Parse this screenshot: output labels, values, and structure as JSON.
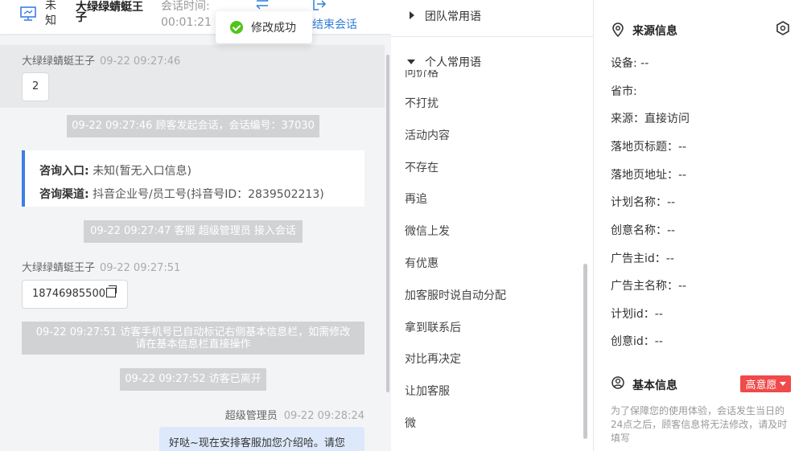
{
  "header": {
    "source": "未知",
    "visitor_name": "大绿绿蜻蜓王子",
    "duration_label": "会话时间:",
    "duration_value": "00:01:21",
    "end_session": "结束会话"
  },
  "toast": {
    "text": "修改成功"
  },
  "messages": {
    "visitor_name": "大绿绿蜻蜓王子",
    "m1_time": "09-22 09:27:46",
    "m1_text": "2",
    "sys1": "09-22 09:27:46 顾客发起会话，会话编号：37030",
    "card_entry_label": "咨询入口:",
    "card_entry_value": "未知(暂无入口信息)",
    "card_channel_label": "咨询渠道:",
    "card_channel_value": "抖音企业号/员工号(抖音号ID：2839502213)",
    "sys2": "09-22 09:27:47 客服 超级管理员 接入会话",
    "m2_time": "09-22 09:27:51",
    "m2_text": "18746985500",
    "sys3_line1": "09-22 09:27:51 访客手机号已自动标记右侧基本信息栏，如需修改",
    "sys3_line2": "请在基本信息栏直接操作",
    "sys4": "09-22 09:27:52 访客已离开",
    "agent_name": "超级管理员",
    "agent_time": "09-22 09:28:24",
    "agent_text": "好哒~现在安排客服加您介绍哈。请您"
  },
  "phrases": {
    "team_group": "团队常用语",
    "personal_group": "个人常用语",
    "cut_item": "问价格",
    "items": [
      "不打扰",
      "活动内容",
      "不存在",
      "再追",
      "微信上发",
      "有优惠",
      "加客服时说自动分配",
      "拿到联系后",
      "对比再决定",
      "让加客服",
      "微"
    ]
  },
  "info": {
    "source_title": "来源信息",
    "fields": [
      "设备: --",
      "省市:",
      "来源：直接访问",
      "落地页标题：--",
      "落地页地址：--",
      "计划名称：--",
      "创意名称：--",
      "广告主id：--",
      "广告主名称：--",
      "计划id：--",
      "创意id：--"
    ],
    "basic_title": "基本信息",
    "intent_badge": "高意愿",
    "notice": "为了保障您的使用体验，会话发生当日的24点之后，顾客信息将无法修改，请及时填写"
  },
  "colors": {
    "accent": "#2f7fd8",
    "card_border": "#3b7fe6",
    "badge": "#f04a4a",
    "success": "#52c41a"
  }
}
